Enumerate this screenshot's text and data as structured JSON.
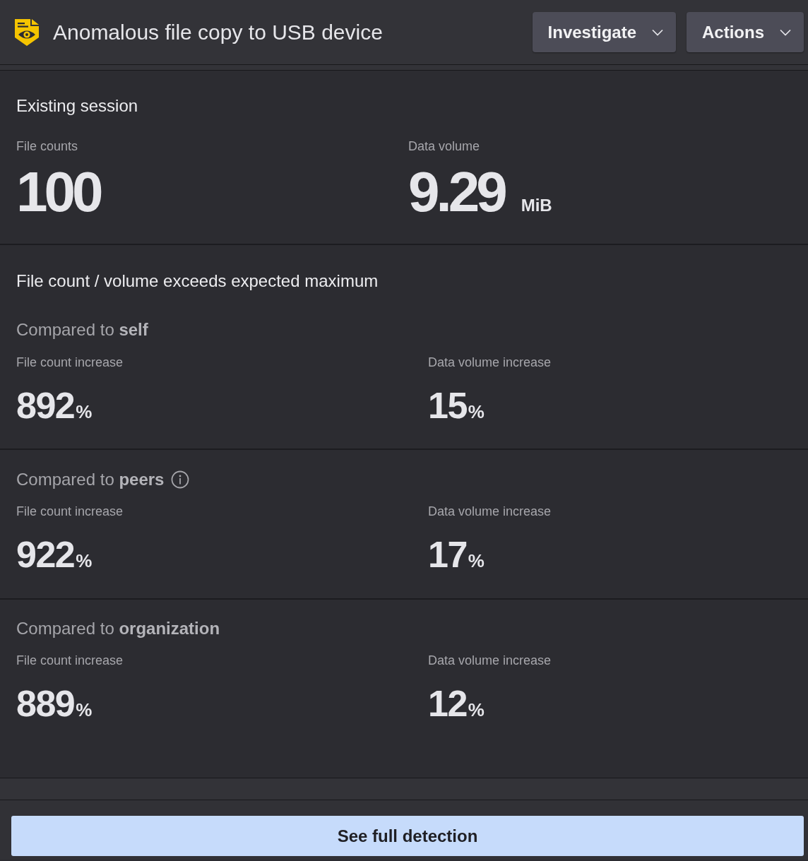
{
  "header": {
    "title": "Anomalous file copy to USB device",
    "buttons": [
      {
        "label": "Investigate"
      },
      {
        "label": "Actions"
      }
    ]
  },
  "session": {
    "title": "Existing session",
    "metrics": [
      {
        "label": "File counts",
        "value": "100"
      },
      {
        "label": "Data volume",
        "value": "9.29",
        "unit": "MiB"
      }
    ]
  },
  "anomaly": {
    "title": "File count / volume exceeds expected maximum",
    "comparisons": [
      {
        "heading": "Compared to **self**",
        "has_info": false,
        "metrics": [
          {
            "label": "File count increase",
            "value": "892",
            "unit": "%"
          },
          {
            "label": "Data volume increase",
            "value": "15",
            "unit": "%"
          }
        ]
      },
      {
        "heading": "Compared to **peers**",
        "has_info": true,
        "metrics": [
          {
            "label": "File count increase",
            "value": "922",
            "unit": "%"
          },
          {
            "label": "Data volume increase",
            "value": "17",
            "unit": "%"
          }
        ]
      },
      {
        "heading": "Compared to **organization**",
        "has_info": false,
        "metrics": [
          {
            "label": "File count increase",
            "value": "889",
            "unit": "%"
          },
          {
            "label": "Data volume increase",
            "value": "12",
            "unit": "%"
          }
        ]
      }
    ]
  },
  "footer": {
    "button": "See full detection"
  }
}
